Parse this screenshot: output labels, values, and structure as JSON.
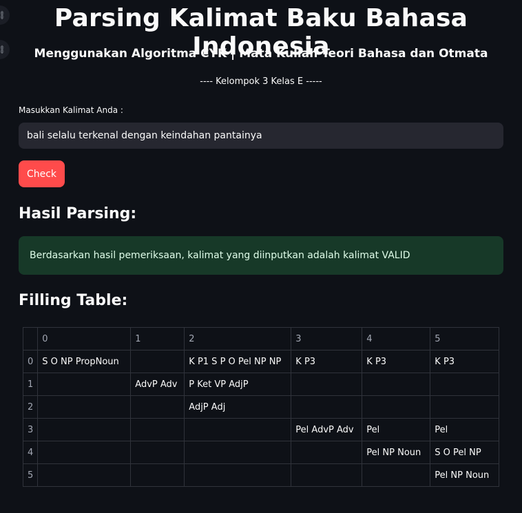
{
  "header": {
    "title": "Parsing Kalimat Baku Bahasa Indonesia",
    "subtitle": "Menggunakan Algoritma CYK | Mata Kuliah Teori Bahasa dan Otmata",
    "group": "---- Kelompok 3 Kelas E -----"
  },
  "side_icons": [
    "link-icon",
    "link-icon"
  ],
  "form": {
    "input_label": "Masukkan Kalimat Anda :",
    "input_value": "bali selalu terkenal dengan keindahan pantainya",
    "button_label": "Check"
  },
  "result": {
    "heading": "Hasil Parsing:",
    "message": "Berdasarkan hasil pemeriksaan, kalimat yang diinputkan adalah kalimat VALID"
  },
  "table": {
    "heading": "Filling Table:",
    "columns": [
      "",
      "0",
      "1",
      "2",
      "3",
      "4",
      "5"
    ],
    "rows": [
      [
        "0",
        "S O NP PropNoun",
        "",
        "K P1 S P O Pel NP NP",
        "K P3",
        "K P3",
        "K P3"
      ],
      [
        "1",
        "",
        "AdvP Adv",
        "P Ket VP AdjP",
        "",
        "",
        ""
      ],
      [
        "2",
        "",
        "",
        "AdjP Adj",
        "",
        "",
        ""
      ],
      [
        "3",
        "",
        "",
        "",
        "Pel AdvP Adv",
        "Pel",
        "Pel"
      ],
      [
        "4",
        "",
        "",
        "",
        "",
        "Pel NP Noun",
        "S O Pel NP"
      ],
      [
        "5",
        "",
        "",
        "",
        "",
        "",
        "Pel NP Noun"
      ]
    ]
  },
  "colors": {
    "background": "#0e1117",
    "button": "#ff4b4b",
    "success_bg": "#173928",
    "input_bg": "#262730"
  }
}
